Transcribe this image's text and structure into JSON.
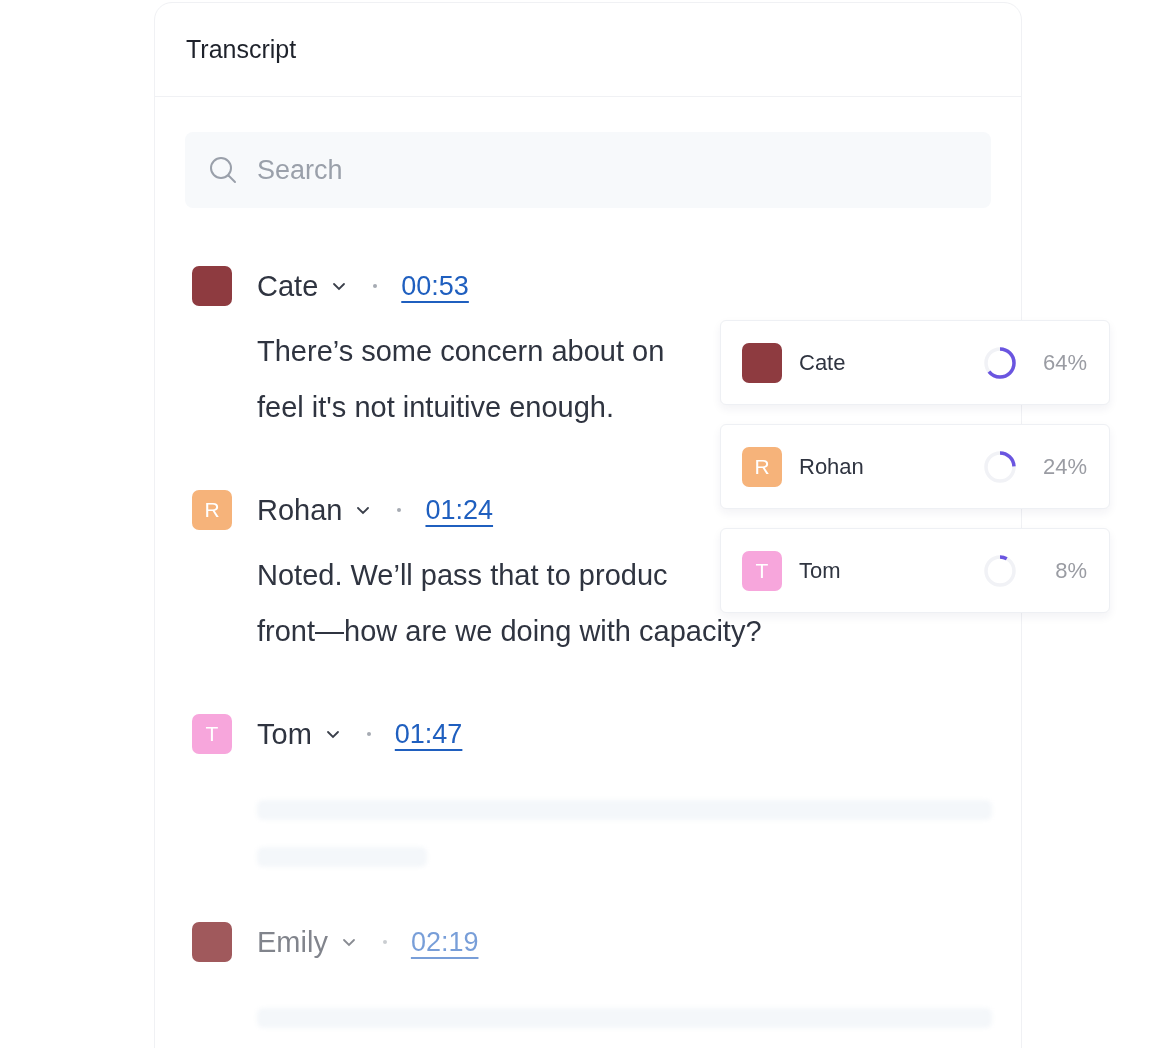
{
  "panel": {
    "title": "Transcript"
  },
  "search": {
    "placeholder": "Search"
  },
  "entries": [
    {
      "speaker": "Cate",
      "avatar": {
        "kind": "photo",
        "color": "#8e3b40"
      },
      "time": "00:53",
      "lines": [
        "There’s some concern about on",
        "feel it's not intuitive enough."
      ],
      "faded": false
    },
    {
      "speaker": "Rohan",
      "avatar": {
        "kind": "initial",
        "initial": "R",
        "color": "#f6b37a"
      },
      "time": "01:24",
      "lines": [
        "Noted. We’ll pass that to produc",
        "front—how are we doing with capacity?"
      ],
      "faded": false
    },
    {
      "speaker": "Tom",
      "avatar": {
        "kind": "initial",
        "initial": "T",
        "color": "#f7a6dc"
      },
      "time": "01:47",
      "faded": false
    },
    {
      "speaker": "Emily",
      "avatar": {
        "kind": "photo",
        "color": "#a0595c"
      },
      "time": "02:19",
      "faded": true
    }
  ],
  "talk_time": [
    {
      "speaker": "Cate",
      "avatar": {
        "kind": "photo",
        "color": "#8e3b40"
      },
      "level": 0.64,
      "reading": "64%"
    },
    {
      "speaker": "Rohan",
      "avatar": {
        "kind": "initial",
        "initial": "R",
        "color": "#f6b37a"
      },
      "level": 0.24,
      "reading": "24%"
    },
    {
      "speaker": "Tom",
      "avatar": {
        "kind": "initial",
        "initial": "T",
        "color": "#f7a6dc"
      },
      "level": 0.08,
      "reading": "8%"
    }
  ]
}
